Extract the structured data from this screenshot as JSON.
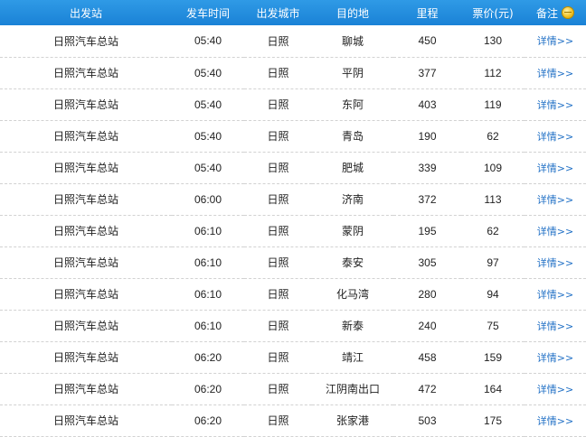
{
  "header": {
    "station": "出发站",
    "time": "发车时间",
    "city": "出发城市",
    "destination": "目的地",
    "distance": "里程",
    "price": "票价(元)",
    "remark": "备注",
    "remark_icon": "coin-icon"
  },
  "rows": [
    {
      "station": "日照汽车总站",
      "time": "05:40",
      "city": "日照",
      "destination": "聊城",
      "distance": "450",
      "price": "130",
      "detail": "详情>>"
    },
    {
      "station": "日照汽车总站",
      "time": "05:40",
      "city": "日照",
      "destination": "平阴",
      "distance": "377",
      "price": "112",
      "detail": "详情>>"
    },
    {
      "station": "日照汽车总站",
      "time": "05:40",
      "city": "日照",
      "destination": "东阿",
      "distance": "403",
      "price": "119",
      "detail": "详情>>"
    },
    {
      "station": "日照汽车总站",
      "time": "05:40",
      "city": "日照",
      "destination": "青岛",
      "distance": "190",
      "price": "62",
      "detail": "详情>>"
    },
    {
      "station": "日照汽车总站",
      "time": "05:40",
      "city": "日照",
      "destination": "肥城",
      "distance": "339",
      "price": "109",
      "detail": "详情>>"
    },
    {
      "station": "日照汽车总站",
      "time": "06:00",
      "city": "日照",
      "destination": "济南",
      "distance": "372",
      "price": "113",
      "detail": "详情>>"
    },
    {
      "station": "日照汽车总站",
      "time": "06:10",
      "city": "日照",
      "destination": "蒙阴",
      "distance": "195",
      "price": "62",
      "detail": "详情>>"
    },
    {
      "station": "日照汽车总站",
      "time": "06:10",
      "city": "日照",
      "destination": "泰安",
      "distance": "305",
      "price": "97",
      "detail": "详情>>"
    },
    {
      "station": "日照汽车总站",
      "time": "06:10",
      "city": "日照",
      "destination": "化马湾",
      "distance": "280",
      "price": "94",
      "detail": "详情>>"
    },
    {
      "station": "日照汽车总站",
      "time": "06:10",
      "city": "日照",
      "destination": "新泰",
      "distance": "240",
      "price": "75",
      "detail": "详情>>"
    },
    {
      "station": "日照汽车总站",
      "time": "06:20",
      "city": "日照",
      "destination": "靖江",
      "distance": "458",
      "price": "159",
      "detail": "详情>>"
    },
    {
      "station": "日照汽车总站",
      "time": "06:20",
      "city": "日照",
      "destination": "江阴南出口",
      "distance": "472",
      "price": "164",
      "detail": "详情>>"
    },
    {
      "station": "日照汽车总站",
      "time": "06:20",
      "city": "日照",
      "destination": "张家港",
      "distance": "503",
      "price": "175",
      "detail": "详情>>"
    }
  ]
}
